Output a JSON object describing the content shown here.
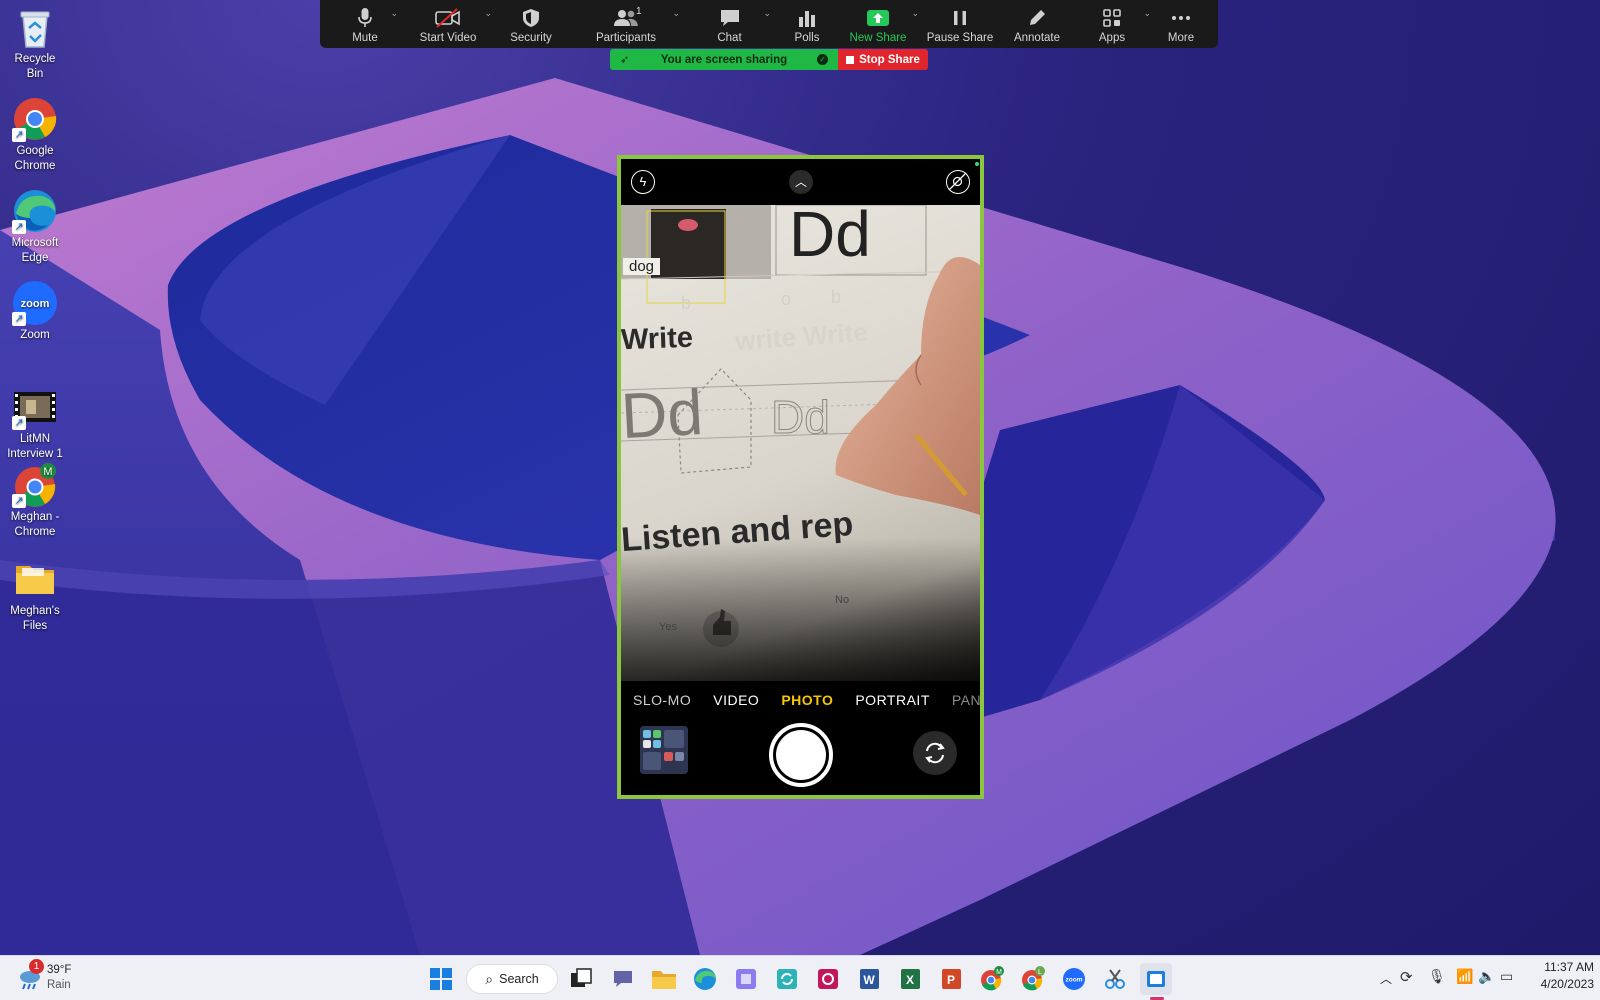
{
  "desktop": {
    "icons": [
      {
        "label_1": "Recycle Bin",
        "label_2": ""
      },
      {
        "label_1": "Google",
        "label_2": "Chrome"
      },
      {
        "label_1": "Microsoft",
        "label_2": "Edge"
      },
      {
        "label_1": "Zoom",
        "label_2": ""
      },
      {
        "label_1": "LitMN",
        "label_2": "Interview 1"
      },
      {
        "label_1": "Meghan -",
        "label_2": "Chrome"
      },
      {
        "label_1": "Meghan's",
        "label_2": "Files"
      }
    ]
  },
  "zoom_toolbar": {
    "buttons": [
      {
        "label": "Mute",
        "icon": "microphone-icon"
      },
      {
        "label": "Start Video",
        "icon": "video-off-icon"
      },
      {
        "label": "Security",
        "icon": "shield-icon"
      },
      {
        "label": "Participants",
        "icon": "participants-icon",
        "count": "1"
      },
      {
        "label": "Chat",
        "icon": "chat-icon"
      },
      {
        "label": "Polls",
        "icon": "polls-icon"
      },
      {
        "label": "New Share",
        "icon": "share-up-icon"
      },
      {
        "label": "Pause Share",
        "icon": "pause-icon"
      },
      {
        "label": "Annotate",
        "icon": "pencil-icon"
      },
      {
        "label": "Apps",
        "icon": "apps-icon"
      },
      {
        "label": "More",
        "icon": "more-dots-icon"
      }
    ],
    "new_share_color": "#24c95a",
    "sharing_banner": "You are screen sharing",
    "stop_share": "Stop Share"
  },
  "phone_camera": {
    "border_color": "#8cc63f",
    "worksheet": {
      "letters": "Dd",
      "picture_label": "dog",
      "write_heading": "Write",
      "listen_heading": "Listen and rep",
      "yes": "Yes",
      "no": "No"
    },
    "modes": [
      "SLO-MO",
      "VIDEO",
      "PHOTO",
      "PORTRAIT",
      "PAN"
    ],
    "active_mode": "PHOTO",
    "active_color": "#f6c700"
  },
  "taskbar": {
    "weather_temp": "39°F",
    "weather_desc": "Rain",
    "weather_badge": "1",
    "search_label": "Search",
    "time": "11:37 AM",
    "date": "4/20/2023"
  }
}
